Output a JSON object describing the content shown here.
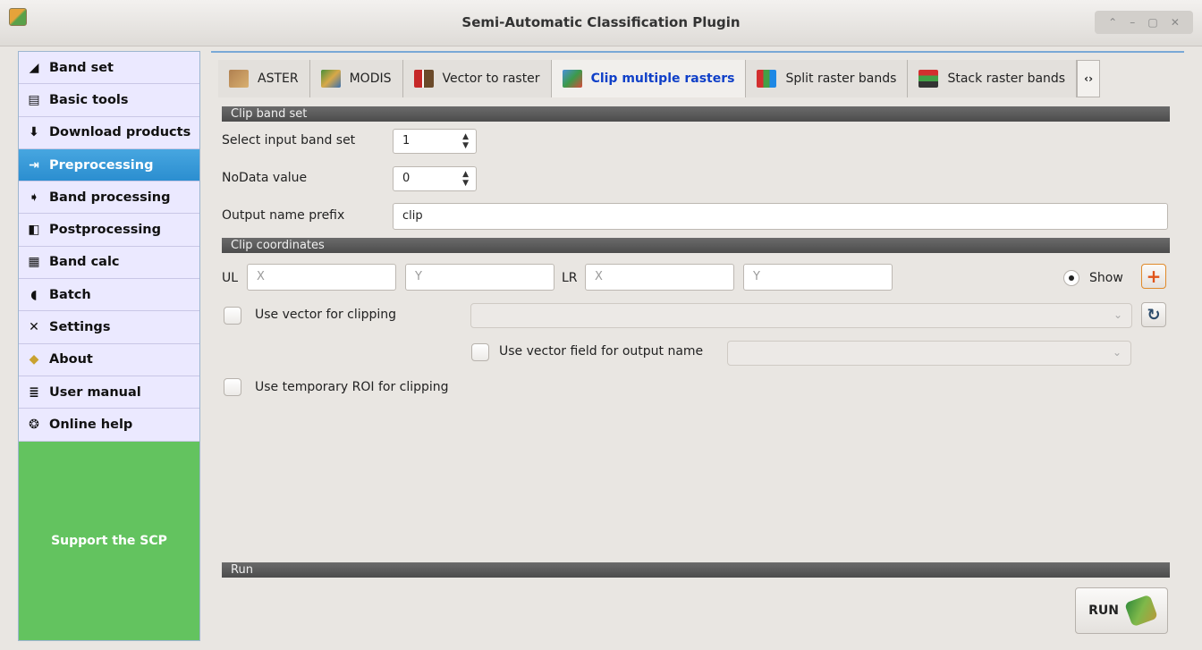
{
  "window": {
    "title": "Semi-Automatic Classification Plugin"
  },
  "sidebar": {
    "items": [
      {
        "label": "Band set",
        "icon": "band-set-icon"
      },
      {
        "label": "Basic tools",
        "icon": "basic-tools-icon"
      },
      {
        "label": "Download products",
        "icon": "download-icon"
      },
      {
        "label": "Preprocessing",
        "icon": "preprocessing-icon",
        "active": true
      },
      {
        "label": "Band processing",
        "icon": "band-processing-icon"
      },
      {
        "label": "Postprocessing",
        "icon": "postprocessing-icon"
      },
      {
        "label": "Band calc",
        "icon": "band-calc-icon"
      },
      {
        "label": "Batch",
        "icon": "batch-icon"
      },
      {
        "label": "Settings",
        "icon": "settings-icon"
      },
      {
        "label": "About",
        "icon": "about-icon"
      },
      {
        "label": "User manual",
        "icon": "user-manual-icon"
      },
      {
        "label": "Online help",
        "icon": "online-help-icon"
      }
    ],
    "support_label": "Support the SCP"
  },
  "tabs": [
    {
      "label": "ASTER"
    },
    {
      "label": "MODIS"
    },
    {
      "label": "Vector to raster"
    },
    {
      "label": "Clip multiple rasters",
      "active": true
    },
    {
      "label": "Split raster bands"
    },
    {
      "label": "Stack raster bands"
    }
  ],
  "sections": {
    "clip_band_set": "Clip band set",
    "clip_coordinates": "Clip coordinates",
    "run": "Run"
  },
  "form": {
    "input_band_set_label": "Select input band set",
    "input_band_set_value": "1",
    "nodata_label": "NoData value",
    "nodata_value": "0",
    "prefix_label": "Output name prefix",
    "prefix_value": "clip",
    "ul_label": "UL",
    "lr_label": "LR",
    "x_placeholder": "X",
    "y_placeholder": "Y",
    "show_label": "Show",
    "use_vector_label": "Use vector for clipping",
    "use_vector_field_label": "Use vector field for output name",
    "use_roi_label": "Use temporary ROI for clipping"
  },
  "run_label": "RUN",
  "colors": {
    "accent": "#2b8ed0",
    "support": "#63c35f",
    "active_tab_text": "#1040c8"
  }
}
